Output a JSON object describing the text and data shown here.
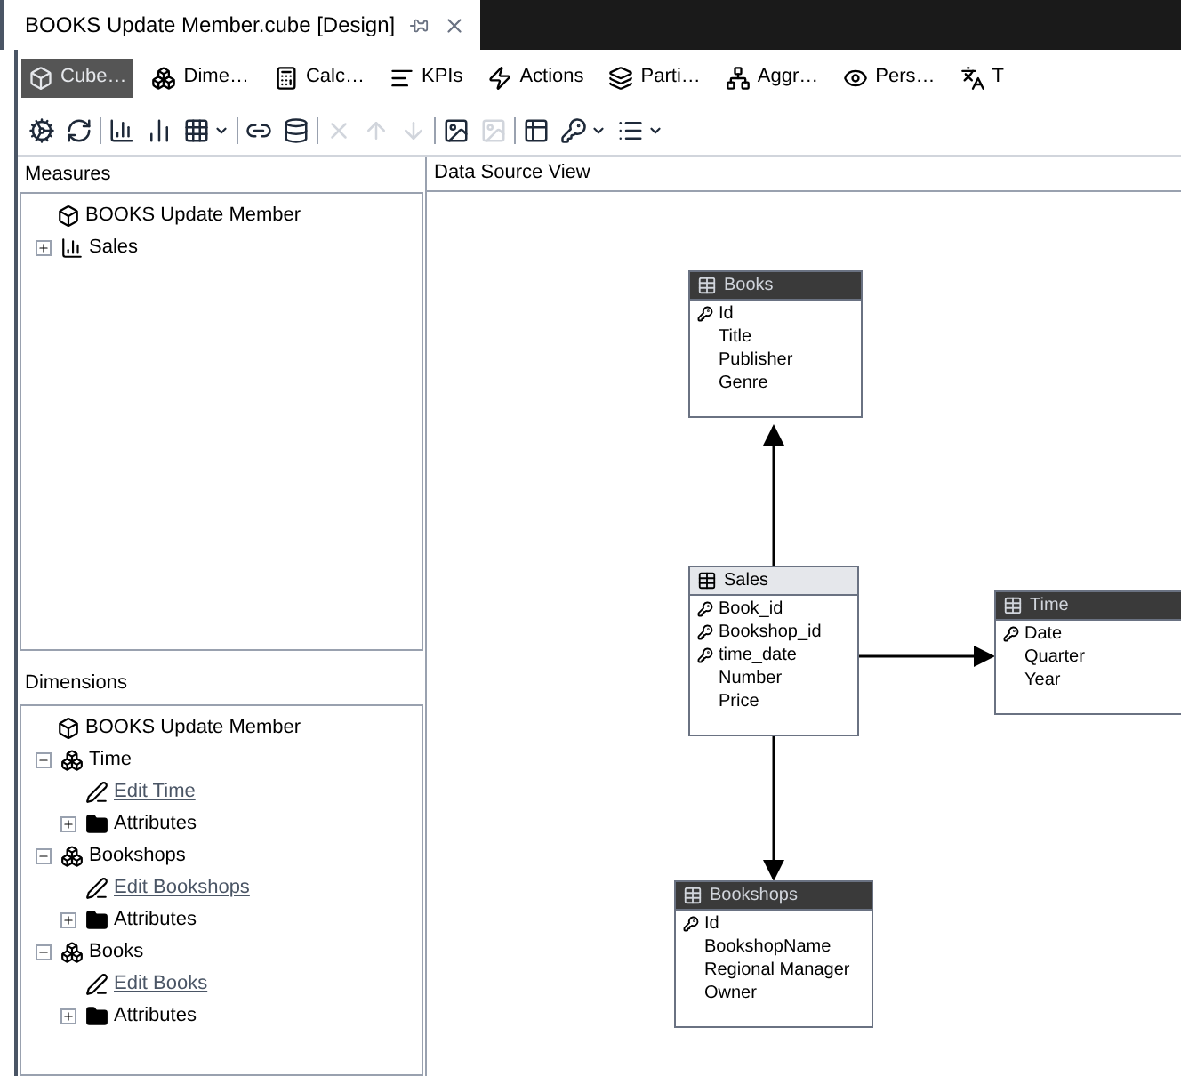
{
  "document_tab": {
    "title": "BOOKS Update Member.cube [Design]"
  },
  "designer_tabs": [
    {
      "label": "Cube…",
      "kind": "cube",
      "selected": true
    },
    {
      "label": "Dime…",
      "kind": "dimension",
      "selected": false
    },
    {
      "label": "Calc…",
      "kind": "calc",
      "selected": false
    },
    {
      "label": "KPIs",
      "kind": "kpi",
      "selected": false
    },
    {
      "label": "Actions",
      "kind": "actions",
      "selected": false
    },
    {
      "label": "Parti…",
      "kind": "partition",
      "selected": false
    },
    {
      "label": "Aggr…",
      "kind": "aggregation",
      "selected": false
    },
    {
      "label": "Pers…",
      "kind": "perspective",
      "selected": false
    },
    {
      "label": "T",
      "kind": "translation",
      "selected": false
    }
  ],
  "toolbar_groups": [
    [
      {
        "kind": "process",
        "disabled": false,
        "dropdown": false
      },
      {
        "kind": "refresh",
        "disabled": false,
        "dropdown": false
      }
    ],
    [
      {
        "kind": "new-measure",
        "disabled": false,
        "dropdown": false
      },
      {
        "kind": "measure",
        "disabled": false,
        "dropdown": false
      },
      {
        "kind": "grid",
        "disabled": false,
        "dropdown": true
      }
    ],
    [
      {
        "kind": "link",
        "disabled": false,
        "dropdown": false
      },
      {
        "kind": "database",
        "disabled": false,
        "dropdown": false
      }
    ],
    [
      {
        "kind": "delete",
        "disabled": true,
        "dropdown": false
      },
      {
        "kind": "up",
        "disabled": true,
        "dropdown": false
      },
      {
        "kind": "down",
        "disabled": true,
        "dropdown": false
      }
    ],
    [
      {
        "kind": "image",
        "disabled": false,
        "dropdown": false
      },
      {
        "kind": "image",
        "disabled": true,
        "dropdown": false
      }
    ],
    [
      {
        "kind": "table",
        "disabled": false,
        "dropdown": false
      },
      {
        "kind": "key",
        "disabled": false,
        "dropdown": true
      },
      {
        "kind": "list",
        "disabled": false,
        "dropdown": true
      }
    ]
  ],
  "measures": {
    "title": "Measures",
    "tree": [
      {
        "label": "BOOKS Update Member",
        "kind": "cube",
        "children": [
          {
            "label": "Sales",
            "kind": "measure-group",
            "expanded": false
          }
        ]
      }
    ]
  },
  "dimensions": {
    "title": "Dimensions",
    "tree": [
      {
        "label": "BOOKS Update Member",
        "kind": "cube",
        "children": [
          {
            "label": "Time",
            "kind": "dimension",
            "expanded": true,
            "children": [
              {
                "label": "Edit Time",
                "kind": "link"
              },
              {
                "label": "Attributes",
                "kind": "folder",
                "expanded": false
              }
            ]
          },
          {
            "label": "Bookshops",
            "kind": "dimension",
            "expanded": true,
            "children": [
              {
                "label": "Edit Bookshops",
                "kind": "link"
              },
              {
                "label": "Attributes",
                "kind": "folder",
                "expanded": false
              }
            ]
          },
          {
            "label": "Books",
            "kind": "dimension",
            "expanded": true,
            "children": [
              {
                "label": "Edit Books",
                "kind": "link"
              },
              {
                "label": "Attributes",
                "kind": "folder",
                "expanded": false
              }
            ]
          }
        ]
      }
    ]
  },
  "data_source_view": {
    "title": "Data Source View",
    "tables": [
      {
        "name": "Books",
        "kind": "dimension",
        "columns": [
          {
            "name": "Id",
            "key": true
          },
          {
            "name": "Title",
            "key": false
          },
          {
            "name": "Publisher",
            "key": false
          },
          {
            "name": "Genre",
            "key": false
          }
        ]
      },
      {
        "name": "Sales",
        "kind": "fact",
        "columns": [
          {
            "name": "Book_id",
            "key": true
          },
          {
            "name": "Bookshop_id",
            "key": true
          },
          {
            "name": "time_date",
            "key": true
          },
          {
            "name": "Number",
            "key": false
          },
          {
            "name": "Price",
            "key": false
          }
        ]
      },
      {
        "name": "Time",
        "kind": "dimension",
        "columns": [
          {
            "name": "Date",
            "key": true
          },
          {
            "name": "Quarter",
            "key": false
          },
          {
            "name": "Year",
            "key": false
          }
        ]
      },
      {
        "name": "Bookshops",
        "kind": "dimension",
        "columns": [
          {
            "name": "Id",
            "key": true
          },
          {
            "name": "BookshopName",
            "key": false
          },
          {
            "name": "Regional Manager",
            "key": false
          },
          {
            "name": "Owner",
            "key": false
          }
        ]
      }
    ]
  }
}
